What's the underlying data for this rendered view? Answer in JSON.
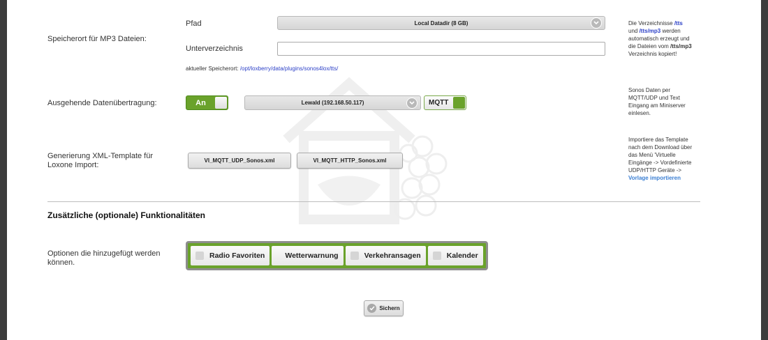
{
  "mp3": {
    "label": "Speicherort für MP3 Dateien:",
    "path_label": "Pfad",
    "path_value": "Local Datadir (8 GB)",
    "subdir_label": "Unterverzeichnis",
    "subdir_value": "",
    "current_prefix": "aktueller Speicherort:",
    "current_path": "/opt/loxberry/data/plugins/sonos4lox/tts/"
  },
  "mp3_help": {
    "l1a": "Die Verzeichnisse ",
    "l1b": "/tts",
    "l2a": "und ",
    "l2b": "/tts/mp3",
    "l2c": " werden",
    "l3": "automatisch erzeugt und",
    "l4a": "die Dateien vom ",
    "l4b": "/tts/mp3",
    "l5": "Verzeichnis kopiert!"
  },
  "outgoing": {
    "label": "Ausgehende Datenübertragung:",
    "toggle_label": "An",
    "server_value": "Lewald (192.168.50.117)",
    "mqtt_label": "MQTT"
  },
  "outgoing_help": {
    "l1": "Sonos Daten per",
    "l2": "MQTT/UDP und Text",
    "l3": "Eingang am Miniserver",
    "l4": "einlesen."
  },
  "xml": {
    "label": "Generierung XML-Template für Loxone Import:",
    "btn_udp": "VI_MQTT_UDP_Sonos.xml",
    "btn_http": "VI_MQTT_HTTP_Sonos.xml"
  },
  "xml_help": {
    "l1": "Importiere das Template",
    "l2": "nach dem Download über",
    "l3": "das Menü 'Virtuelle",
    "l4": "Eingänge -> Vordefinierte",
    "l5": "UDP/HTTP Geräte ->",
    "l6": "Vorlage importieren"
  },
  "optional": {
    "title": "Zusätzliche (optionale) Funktionalitäten",
    "label": "Optionen die hinzugefügt werden können.",
    "options": [
      "Radio Favoriten",
      "Wetterwarnung",
      "Verkehransagen",
      "Kalender"
    ]
  },
  "save_label": "Sichern",
  "colors": {
    "green": "#6aa22b",
    "link": "#2b3fc7"
  },
  "icons": [
    "chevron-down-icon",
    "check-icon",
    "loxberry-watermark-icon"
  ]
}
